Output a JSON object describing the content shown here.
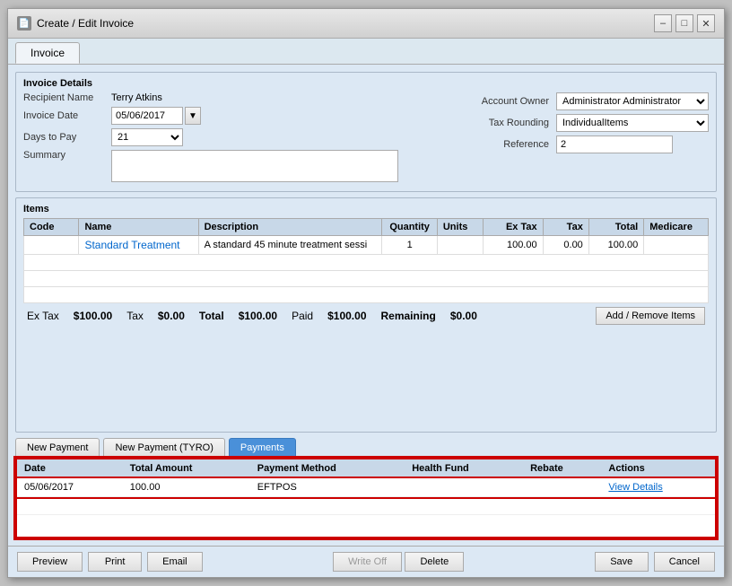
{
  "window": {
    "title": "Create / Edit Invoice",
    "icon": "📄"
  },
  "titleButtons": {
    "minimize": "–",
    "maximize": "□",
    "close": "✕"
  },
  "tabs": [
    {
      "label": "Invoice",
      "active": true
    }
  ],
  "invoiceDetails": {
    "sectionTitle": "Invoice Details",
    "recipientLabel": "Recipient Name",
    "recipientValue": "Terry Atkins",
    "invoiceDateLabel": "Invoice Date",
    "invoiceDateValue": "05/06/2017",
    "daysToPayLabel": "Days to Pay",
    "daysToPayValue": "21",
    "summaryLabel": "Summary",
    "summaryValue": "",
    "accountOwnerLabel": "Account Owner",
    "accountOwnerValue": "Administrator Administrator",
    "taxRoundingLabel": "Tax Rounding",
    "taxRoundingValue": "IndividualItems",
    "referenceLabel": "Reference",
    "referenceValue": "2"
  },
  "items": {
    "sectionTitle": "Items",
    "columns": [
      "Code",
      "Name",
      "Description",
      "Quantity",
      "Units",
      "Ex Tax",
      "Tax",
      "Total",
      "Medicare"
    ],
    "rows": [
      {
        "code": "",
        "name": "Standard Treatment",
        "description": "A standard 45 minute treatment sessi",
        "quantity": "1",
        "units": "",
        "exTax": "100.00",
        "tax": "0.00",
        "total": "100.00",
        "medicare": ""
      }
    ],
    "footer": {
      "exTaxLabel": "Ex Tax",
      "exTaxValue": "$100.00",
      "taxLabel": "Tax",
      "taxValue": "$0.00",
      "totalLabel": "Total",
      "totalValue": "$100.00",
      "paidLabel": "Paid",
      "paidValue": "$100.00",
      "remainingLabel": "Remaining",
      "remainingValue": "$0.00",
      "addRemoveBtn": "Add / Remove Items"
    }
  },
  "paymentTabs": [
    {
      "label": "New Payment",
      "active": false
    },
    {
      "label": "New Payment (TYRO)",
      "active": false
    },
    {
      "label": "Payments",
      "active": true
    }
  ],
  "paymentsTable": {
    "columns": [
      "Date",
      "Total Amount",
      "Payment Method",
      "Health Fund",
      "Rebate",
      "Actions"
    ],
    "rows": [
      {
        "date": "05/06/2017",
        "totalAmount": "100.00",
        "paymentMethod": "EFTPOS",
        "healthFund": "",
        "rebate": "",
        "action": "View Details"
      }
    ]
  },
  "bottomBar": {
    "preview": "Preview",
    "print": "Print",
    "email": "Email",
    "writeOff": "Write Off",
    "delete": "Delete",
    "save": "Save",
    "cancel": "Cancel"
  }
}
